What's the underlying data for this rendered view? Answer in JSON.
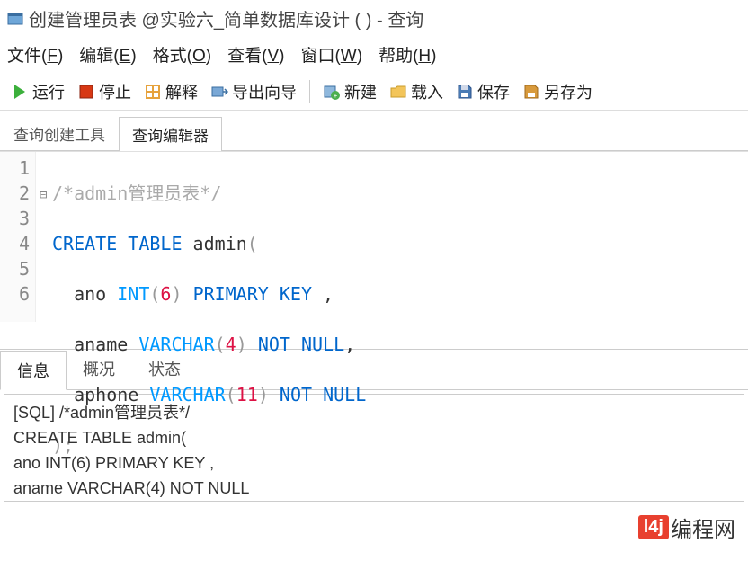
{
  "title": "创建管理员表 @实验六_简单数据库设计 (          ) - 查询",
  "menu": {
    "file": "文件",
    "file_k": "F",
    "edit": "编辑",
    "edit_k": "E",
    "format": "格式",
    "format_k": "O",
    "view": "查看",
    "view_k": "V",
    "window": "窗口",
    "window_k": "W",
    "help": "帮助",
    "help_k": "H"
  },
  "toolbar": {
    "run": "运行",
    "stop": "停止",
    "explain": "解释",
    "export": "导出向导",
    "new": "新建",
    "load": "载入",
    "save": "保存",
    "saveas": "另存为"
  },
  "tabs": {
    "builder": "查询创建工具",
    "editor": "查询编辑器"
  },
  "code": {
    "l1_comment": "/*admin管理员表*/",
    "l2_kw1": "CREATE",
    "l2_kw2": "TABLE",
    "l2_ident": " admin",
    "l3_pre": "  ano ",
    "l3_type": "INT",
    "l3_num": "6",
    "l3_kw": "PRIMARY KEY",
    "l3_tail": " ,",
    "l4_pre": "  aname ",
    "l4_type": "VARCHAR",
    "l4_num": "4",
    "l4_kw": "NOT NULL",
    "l4_tail": ",",
    "l5_pre": "  aphone ",
    "l5_type": "VARCHAR",
    "l5_num": "11",
    "l5_kw": "NOT NULL",
    "l6": ");"
  },
  "lines": {
    "n1": "1",
    "n2": "2",
    "n3": "3",
    "n4": "4",
    "n5": "5",
    "n6": "6"
  },
  "bottomTabs": {
    "info": "信息",
    "summary": "概况",
    "status": "状态"
  },
  "output": {
    "l1": "[SQL] /*admin管理员表*/",
    "l2": "CREATE TABLE admin(",
    "l3": "           ano INT(6) PRIMARY KEY ,",
    "l4": "           aname VARCHAR(4) NOT NULL"
  },
  "watermark": {
    "badge": "l4j",
    "text": "编程网"
  }
}
